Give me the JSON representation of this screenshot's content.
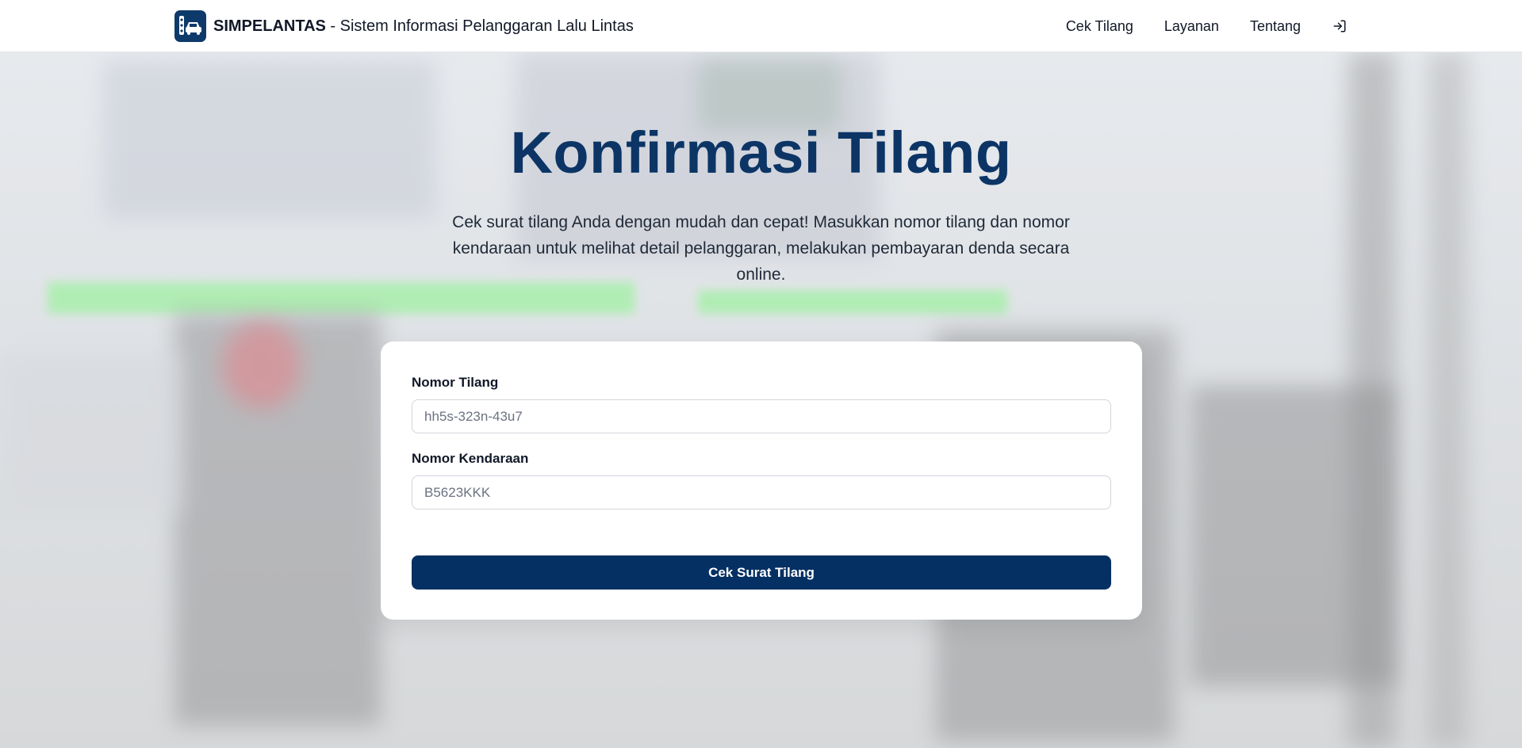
{
  "header": {
    "brand_name": "SIMPELANTAS",
    "brand_tagline": " - Sistem Informasi Pelanggaran Lalu Lintas",
    "logo_icon": "car-traffic-light-icon",
    "nav": [
      {
        "label": "Cek Tilang"
      },
      {
        "label": "Layanan"
      },
      {
        "label": "Tentang"
      }
    ],
    "login_icon": "sign-in-icon"
  },
  "hero": {
    "title": "Konfirmasi Tilang",
    "subtitle": "Cek surat tilang Anda dengan mudah dan cepat! Masukkan nomor tilang dan nomor kendaraan untuk melihat detail pelanggaran, melakukan pembayaran denda secara online."
  },
  "form": {
    "ticket": {
      "label": "Nomor Tilang",
      "value": "",
      "placeholder": "hh5s-323n-43u7"
    },
    "vehicle": {
      "label": "Nomor Kendaraan",
      "value": "",
      "placeholder": "B5623KKK"
    },
    "submit_label": "Cek Surat Tilang"
  },
  "colors": {
    "primary": "#053063",
    "title": "#0c3566",
    "logo_bg": "#0e3a6b"
  }
}
